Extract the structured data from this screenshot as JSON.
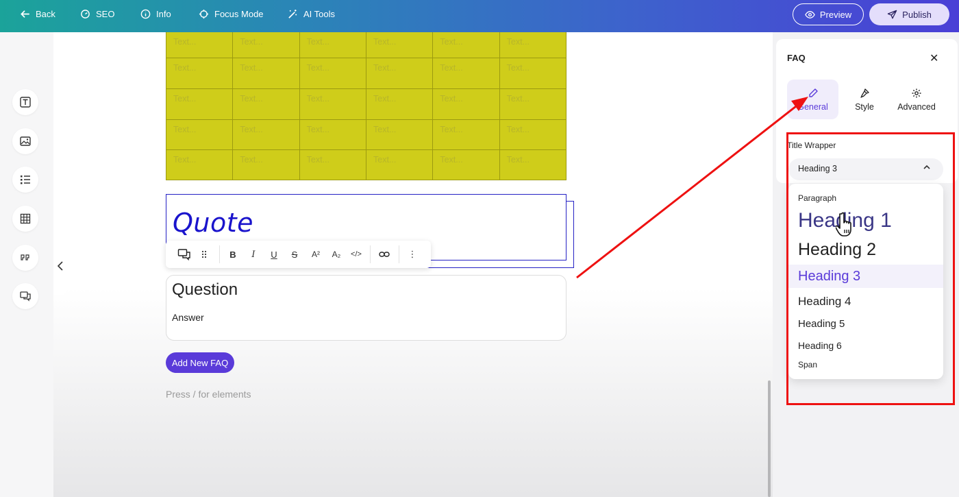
{
  "topbar": {
    "back_label": "Back",
    "seo_label": "SEO",
    "info_label": "Info",
    "focus_label": "Focus Mode",
    "ai_label": "AI Tools",
    "preview_label": "Preview",
    "publish_label": "Publish",
    "gradient_start": "#1ba39a",
    "gradient_end": "#4a3fd6"
  },
  "left_rail": {
    "icons": [
      "text-icon",
      "image-icon",
      "list-icon",
      "table-icon",
      "quote-icon",
      "faq-icon"
    ]
  },
  "canvas": {
    "table": {
      "fill_color": "#cfcd1a",
      "rows": [
        [
          "Text...",
          "Text...",
          "Text...",
          "Text...",
          "Text...",
          "Text..."
        ],
        [
          "Text...",
          "Text...",
          "Text...",
          "Text...",
          "Text...",
          "Text..."
        ],
        [
          "Text...",
          "Text...",
          "Text...",
          "Text...",
          "Text...",
          "Text..."
        ],
        [
          "Text...",
          "Text...",
          "Text...",
          "Text...",
          "Text...",
          "Text..."
        ],
        [
          "Text...",
          "Text...",
          "Text...",
          "Text...",
          "Text...",
          "Text..."
        ]
      ]
    },
    "quote_text": "Quote",
    "toolbar": {
      "bold": "B",
      "italic": "I",
      "underline": "U",
      "strike": "S",
      "superscript": "A²",
      "subscript": "A₂",
      "code": "</>",
      "more": "⋮"
    },
    "faq": {
      "question": "Question",
      "answer": "Answer",
      "add_label": "Add New FAQ"
    },
    "hint": "Press / for elements"
  },
  "panel": {
    "title": "FAQ",
    "close": "✕",
    "tabs": [
      {
        "label": "General",
        "active": true
      },
      {
        "label": "Style",
        "active": false
      },
      {
        "label": "Advanced",
        "active": false
      }
    ],
    "field_label": "Title Wrapper",
    "selected": "Heading 3",
    "chevron": "⌃",
    "options": [
      "Paragraph",
      "Heading 1",
      "Heading 2",
      "Heading 3",
      "Heading 4",
      "Heading 5",
      "Heading 6",
      "Span"
    ],
    "accent_color": "#5a3bd9",
    "annotation_color": "#ee1111"
  }
}
